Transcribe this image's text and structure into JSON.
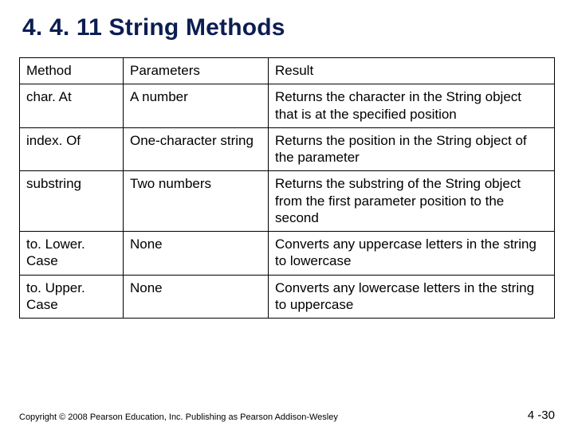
{
  "title": "4. 4. 11 String Methods",
  "table": {
    "headers": {
      "c0": "Method",
      "c1": "Parameters",
      "c2": "Result"
    },
    "rows": [
      {
        "c0": "char. At",
        "c1": " A number",
        "c2": "Returns the character in the String object that is at the specified position"
      },
      {
        "c0": "index. Of",
        "c1": "One-character string",
        "c2": "Returns the position in the String object of the parameter"
      },
      {
        "c0": "substring",
        "c1": "Two numbers",
        "c2": "Returns the substring of the String object from the first parameter position to the second"
      },
      {
        "c0": "to. Lower. Case",
        "c1": "None",
        "c2": "Converts any uppercase letters in the string to lowercase"
      },
      {
        "c0": "to. Upper. Case",
        "c1": "None",
        "c2": "Converts any lowercase letters in the string to uppercase"
      }
    ]
  },
  "footer": "Copyright © 2008 Pearson Education, Inc. Publishing as Pearson Addison-Wesley",
  "pagenum": "4 -30"
}
